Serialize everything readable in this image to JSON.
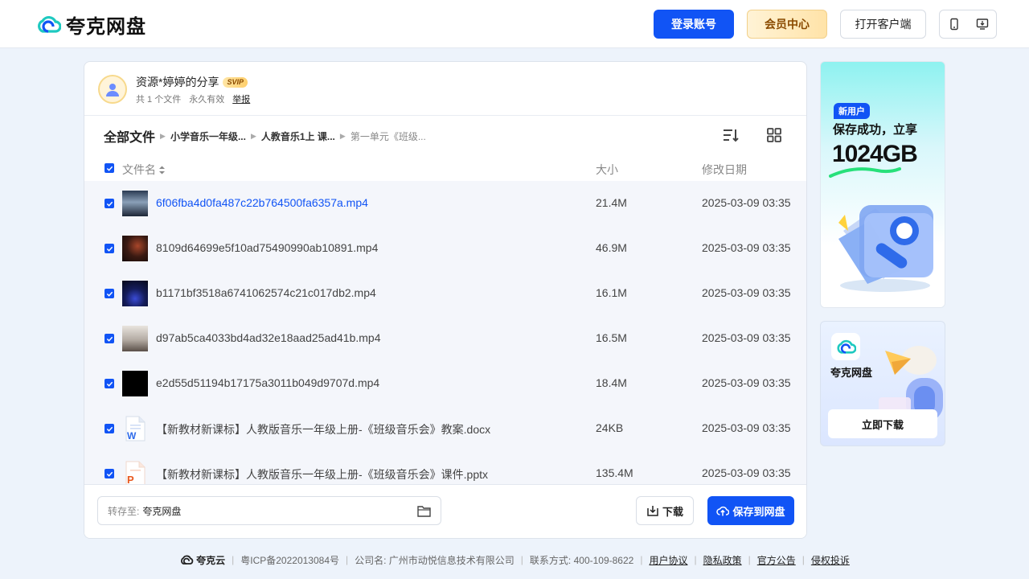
{
  "header": {
    "logo_text": "夸克网盘",
    "login_label": "登录账号",
    "vip_label": "会员中心",
    "client_label": "打开客户端"
  },
  "share": {
    "title": "资源*婷婷的分享",
    "badge": "SVIP",
    "file_count": "共 1 个文件",
    "validity": "永久有效",
    "report": "举报"
  },
  "breadcrumb": {
    "root": "全部文件",
    "items": [
      "小学音乐一年级...",
      "人教音乐1上 课...",
      "第一单元《班级..."
    ]
  },
  "table": {
    "headers": {
      "name": "文件名",
      "size": "大小",
      "date": "修改日期"
    },
    "rows": [
      {
        "name": "6f06fba4d0fa487c22b764500fa6357a.mp4",
        "size": "21.4M",
        "date": "2025-03-09 03:35",
        "type": "video-icon"
      },
      {
        "name": "8109d64699e5f10ad75490990ab10891.mp4",
        "size": "46.9M",
        "date": "2025-03-09 03:35",
        "type": "video-icon"
      },
      {
        "name": "b1171bf3518a6741062574c21c017db2.mp4",
        "size": "16.1M",
        "date": "2025-03-09 03:35",
        "type": "video-icon"
      },
      {
        "name": "d97ab5ca4033bd4ad32e18aad25ad41b.mp4",
        "size": "16.5M",
        "date": "2025-03-09 03:35",
        "type": "video-icon"
      },
      {
        "name": "e2d55d51194b17175a3011b049d9707d.mp4",
        "size": "18.4M",
        "date": "2025-03-09 03:35",
        "type": "video-icon"
      },
      {
        "name": "【新教材新课标】人教版音乐一年级上册-《班级音乐会》教案.docx",
        "size": "24KB",
        "date": "2025-03-09 03:35",
        "type": "word-doc-icon"
      },
      {
        "name": "【新教材新课标】人教版音乐一年级上册-《班级音乐会》课件.pptx",
        "size": "135.4M",
        "date": "2025-03-09 03:35",
        "type": "ppt-icon"
      }
    ]
  },
  "bottom": {
    "save_to_label": "转存至:",
    "save_to_value": "夸克网盘",
    "download_label": "下载",
    "save_label": "保存到网盘"
  },
  "ads": {
    "ad1": {
      "tag": "新用户",
      "line1": "保存成功，立享",
      "line2": "1024GB"
    },
    "ad2": {
      "app_name": "夸克网盘",
      "button": "立即下载"
    }
  },
  "footer": {
    "brand": "夸克云",
    "icp": "粤ICP备2022013084号",
    "company": "公司名: 广州市动悦信息技术有限公司",
    "contact": "联系方式: 400-109-8622",
    "links": [
      "用户协议",
      "隐私政策",
      "官方公告",
      "侵权投诉"
    ]
  },
  "colors": {
    "accent": "#1154f5",
    "background": "#edf3fb",
    "vip_gold": "#8a4a00"
  }
}
